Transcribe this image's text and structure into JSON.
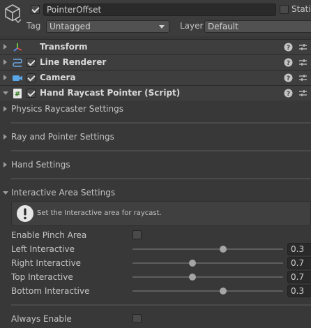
{
  "header": {
    "object_name": "PointerOffset",
    "active": true,
    "static_label": "Static",
    "static_checked": false,
    "tag_label": "Tag",
    "tag_value": "Untagged",
    "layer_label": "Layer",
    "layer_value": "Default"
  },
  "components": [
    {
      "name": "Transform",
      "icon": "transform-icon",
      "has_toggle": false
    },
    {
      "name": "Line Renderer",
      "icon": "line-renderer-icon",
      "has_toggle": true,
      "enabled": true
    },
    {
      "name": "Camera",
      "icon": "camera-icon",
      "has_toggle": true,
      "enabled": true
    },
    {
      "name": "Hand Raycast Pointer (Script)",
      "icon": "script-icon",
      "has_toggle": true,
      "enabled": true,
      "expanded": true
    }
  ],
  "sections": [
    {
      "label": "Physics Raycaster Settings",
      "expanded": false
    },
    {
      "label": "Ray and Pointer Settings",
      "expanded": false
    },
    {
      "label": "Hand Settings",
      "expanded": false
    },
    {
      "label": "Interactive Area Settings",
      "expanded": true
    }
  ],
  "interactive_area": {
    "help_text": "Set the Interactive area for raycast.",
    "enable_pinch_area_label": "Enable Pinch Area",
    "enable_pinch_area": false,
    "sliders": [
      {
        "label": "Left Interactive",
        "value": "0.3",
        "fraction": 0.6
      },
      {
        "label": "Right Interactive",
        "value": "0.7",
        "fraction": 0.4
      },
      {
        "label": "Top Interactive",
        "value": "0.7",
        "fraction": 0.4
      },
      {
        "label": "Bottom Interactive",
        "value": "0.3",
        "fraction": 0.6
      }
    ]
  },
  "always_enable_label": "Always Enable",
  "always_enable": false
}
